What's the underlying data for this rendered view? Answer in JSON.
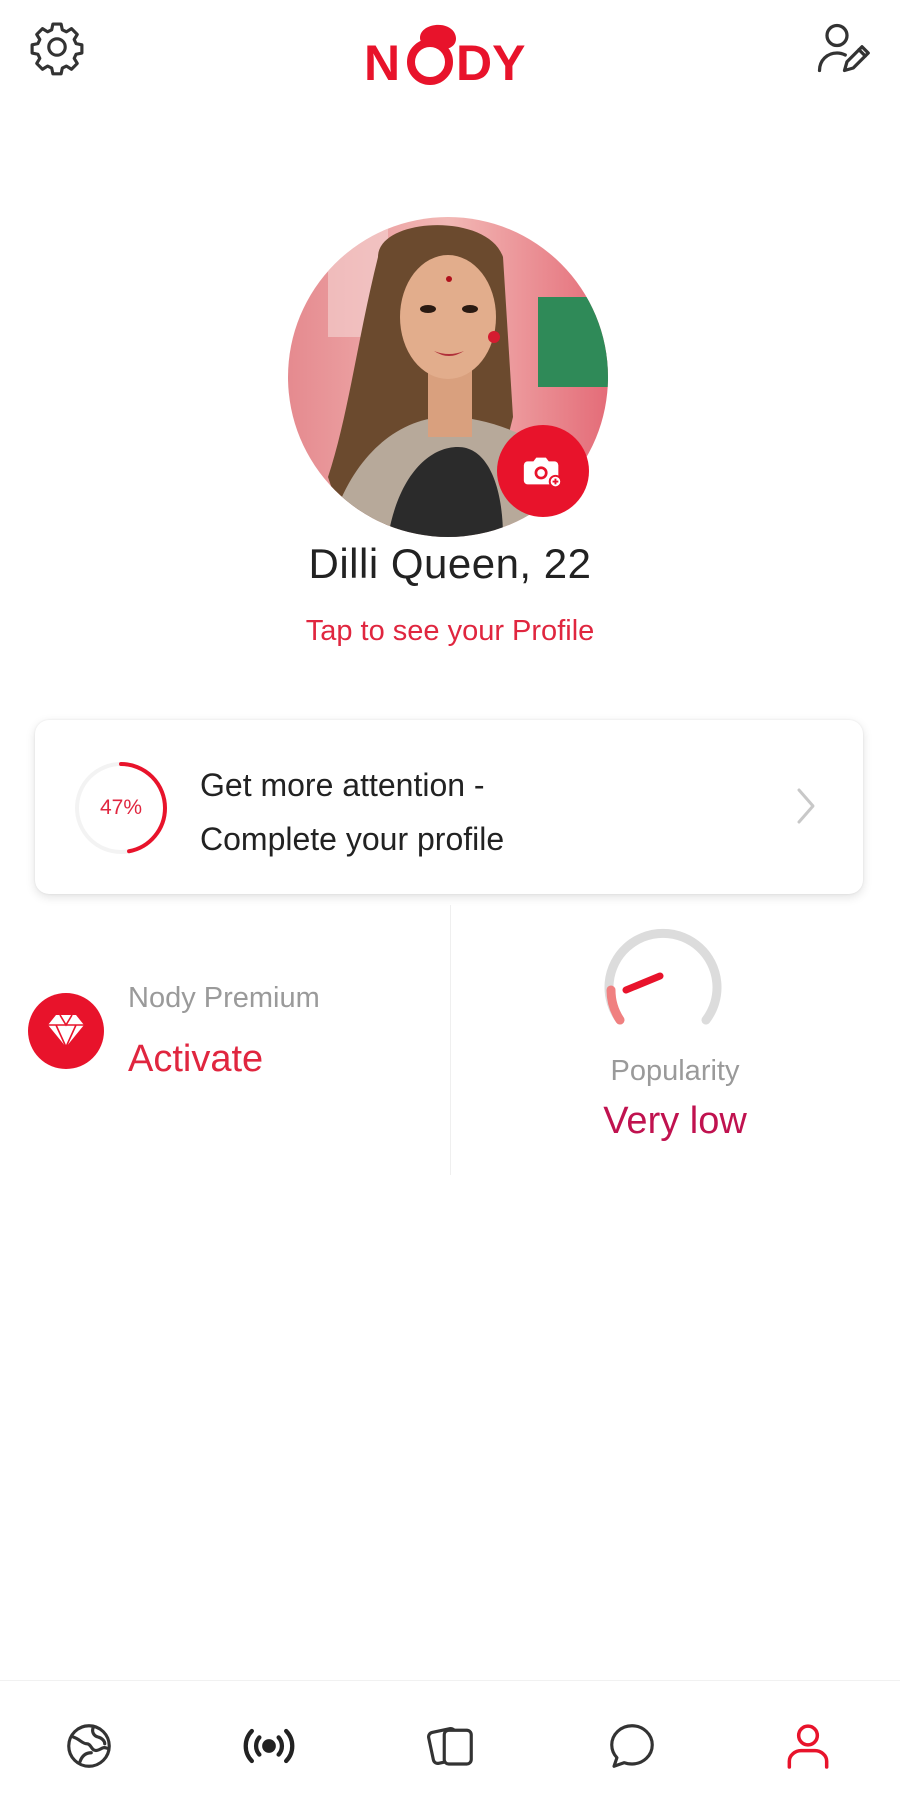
{
  "app": {
    "brand": "NODY",
    "accent_color": "#e8132b"
  },
  "header": {
    "left_icon": "gear-icon",
    "right_icon": "edit-profile-icon"
  },
  "profile": {
    "name_age": "Dilli Queen, 22",
    "tap_link": "Tap to see your Profile",
    "camera_icon": "camera-icon"
  },
  "completion_card": {
    "percent_label": "47%",
    "percent_value": 0.47,
    "line1": "Get more attention -",
    "line2": "Complete your profile",
    "chevron": "chevron-right-icon"
  },
  "premium": {
    "label": "Nody Premium",
    "action": "Activate",
    "icon": "diamond-icon"
  },
  "popularity": {
    "label": "Popularity",
    "value": "Very low",
    "icon": "gauge-icon"
  },
  "bottom_nav": {
    "items": [
      {
        "icon": "globe-icon",
        "active": false
      },
      {
        "icon": "live-broadcast-icon",
        "active": false
      },
      {
        "icon": "cards-icon",
        "active": false
      },
      {
        "icon": "chat-bubble-icon",
        "active": false
      },
      {
        "icon": "user-icon",
        "active": true
      }
    ]
  }
}
